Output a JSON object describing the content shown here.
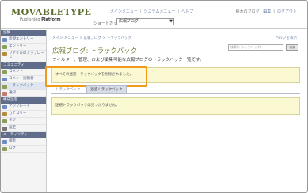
{
  "header": {
    "logo_text": "MOVABLETYPE",
    "logo_sub_prefix": "Publishing",
    "logo_sub_bold": "Platform",
    "topnav": [
      "メインメニュー",
      "システムメニュー",
      "ヘルプ"
    ],
    "shortcut_label": "ショートカット",
    "blog_select_value": "広報ブログ",
    "user_text": "鈴木のブログ:",
    "user_links": [
      "編集",
      "ログアウト"
    ]
  },
  "sidebar": {
    "sections": [
      {
        "title": "投稿",
        "items": [
          {
            "label": "新規エントリー",
            "icon": "new-entry-icon",
            "color": "#6e8cc4"
          },
          {
            "label": "エントリー",
            "icon": "entry-icon",
            "color": "#8aa05a"
          },
          {
            "label": "ファイルのアップロード",
            "icon": "upload-icon",
            "color": "#b48a3c"
          }
        ]
      },
      {
        "title": "コミュニティ",
        "items": [
          {
            "label": "コメント",
            "icon": "comment-icon",
            "color": "#8aa05a"
          },
          {
            "label": "コメント投稿者",
            "icon": "commenter-icon",
            "color": "#6e8cc4"
          },
          {
            "label": "トラックバック",
            "icon": "trackback-icon",
            "color": "#8aa05a",
            "active": true
          },
          {
            "label": "通知",
            "icon": "notification-icon",
            "color": "#c47a6e"
          }
        ]
      },
      {
        "title": "構成設定",
        "items": [
          {
            "label": "テンプレート",
            "icon": "template-icon",
            "color": "#6e8cc4"
          },
          {
            "label": "カテゴリー",
            "icon": "category-icon",
            "color": "#b48a3c"
          },
          {
            "label": "タグ",
            "icon": "tag-icon",
            "color": "#8aa05a"
          },
          {
            "label": "設定",
            "icon": "settings-icon",
            "color": "#777777"
          }
        ]
      },
      {
        "title": "ユーティリティ",
        "items": [
          {
            "label": "検索",
            "icon": "search-icon",
            "color": "#6e8cc4"
          },
          {
            "label": "ログ",
            "icon": "log-icon",
            "color": "#8aa05a"
          }
        ]
      }
    ]
  },
  "main": {
    "breadcrumb": "メイン メニュー > 広報ブログ > トラックバック",
    "help_link": "ヘルプを表示",
    "title": "広報ブログ: トラックバック",
    "description": "フィルター、管理、および編集可能な広報ブログのトラックバック一覧です。",
    "search_placeholder": "検索(トラックバック)",
    "search_button": "検索",
    "success_message": "すべての迷惑トラックバックを削除されました。",
    "tabs": [
      "トラックバック",
      "迷惑トラックバック"
    ],
    "empty_message": "迷惑トラックバックは見つかりません。"
  }
}
